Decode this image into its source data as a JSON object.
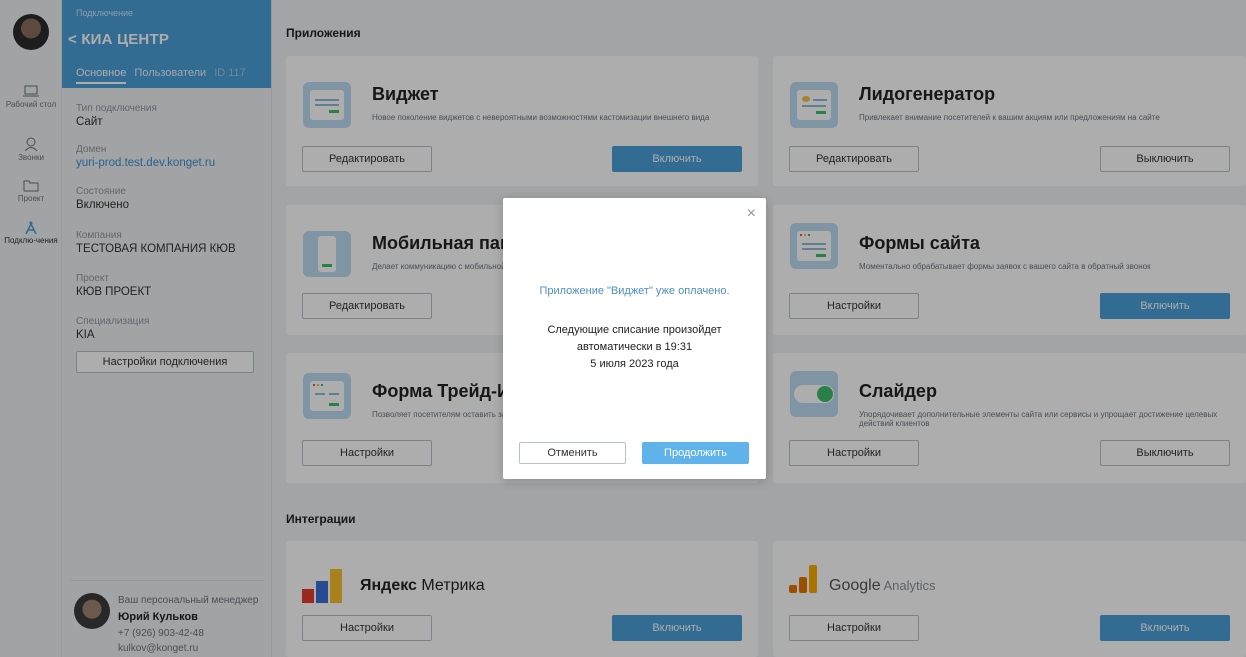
{
  "rail": {
    "items": [
      {
        "label": "Рабочий стол",
        "icon": "laptop-icon"
      },
      {
        "label": "Звонки",
        "icon": "user-icon"
      },
      {
        "label": "Проект",
        "icon": "folder-icon"
      },
      {
        "label": "Подклю-чения",
        "icon": "antenna-icon"
      }
    ]
  },
  "panel": {
    "subtitle": "Подключение",
    "title": "< КИА ЦЕНТР",
    "tabs": {
      "main": "Основное",
      "users": "Пользователи",
      "id": "ID 117"
    },
    "fields": [
      {
        "label": "Тип подключения",
        "value": "Сайт"
      },
      {
        "label": "Домен",
        "value": "yuri-prod.test.dev.konget.ru"
      },
      {
        "label": "Состояние",
        "value": "Включено"
      },
      {
        "label": "Компания",
        "value": "ТЕСТОВАЯ КОМПАНИЯ КЮВ"
      },
      {
        "label": "Проект",
        "value": "КЮВ ПРОЕКТ"
      },
      {
        "label": "Специализация",
        "value": "KIA"
      }
    ],
    "settings_button": "Настройки подключения",
    "manager": {
      "caption": "Ваш персональный менеджер",
      "name": "Юрий Кульков",
      "phone": "+7 (926) 903-42-48",
      "email": "kulkov@konget.ru"
    }
  },
  "main": {
    "apps_title": "Приложения",
    "integrations_title": "Интеграции",
    "apps": [
      {
        "title": "Виджет",
        "desc": "Новое поколение виджетов с невероятными возможностями кастомизации внешнего вида",
        "left_btn": "Редактировать",
        "right_btn": "Включить"
      },
      {
        "title": "Лидогенератор",
        "desc": "Привлекает внимание посетителей к вашим акциям или предложениям на сайте",
        "left_btn": "Редактировать",
        "right_btn": "Выключить"
      },
      {
        "title": "Мобильная панель",
        "desc": "Делает коммуникацию с мобильной",
        "left_btn": "Редактировать",
        "right_btn": ""
      },
      {
        "title": "Формы сайта",
        "desc": "Моментально обрабатывает формы заявок с вашего сайта в обратный звонок",
        "left_btn": "Настройки",
        "right_btn": "Включить"
      },
      {
        "title": "Форма Трейд-Ин",
        "desc": "Позволяет посетителям оставить за",
        "left_btn": "Настройки",
        "right_btn": ""
      },
      {
        "title": "Слайдер",
        "desc": "Упорядочивает дополнительные элементы сайта или сервисы и упрощает достижение целевых действий клиентов",
        "left_btn": "Настройки",
        "right_btn": "Выключить"
      }
    ],
    "integrations": [
      {
        "brand_bold": "Яндекс",
        "brand_rest": " Метрика",
        "left_btn": "Настройки",
        "right_btn": "Включить"
      },
      {
        "brand_bold": "Google",
        "brand_rest": " Analytics",
        "left_btn": "Настройки",
        "right_btn": "Включить"
      }
    ]
  },
  "modal": {
    "close": "×",
    "paid_text": "Приложение \"Виджет\" уже оплачено.",
    "next_line1": "Следующие списание произойдет",
    "next_line2": "автоматически в 19:31",
    "next_line3": "5 июля 2023 года",
    "cancel": "Отменить",
    "continue": "Продолжить"
  },
  "colors": {
    "accent": "#4aa0d9",
    "green": "#3ebe6b"
  }
}
